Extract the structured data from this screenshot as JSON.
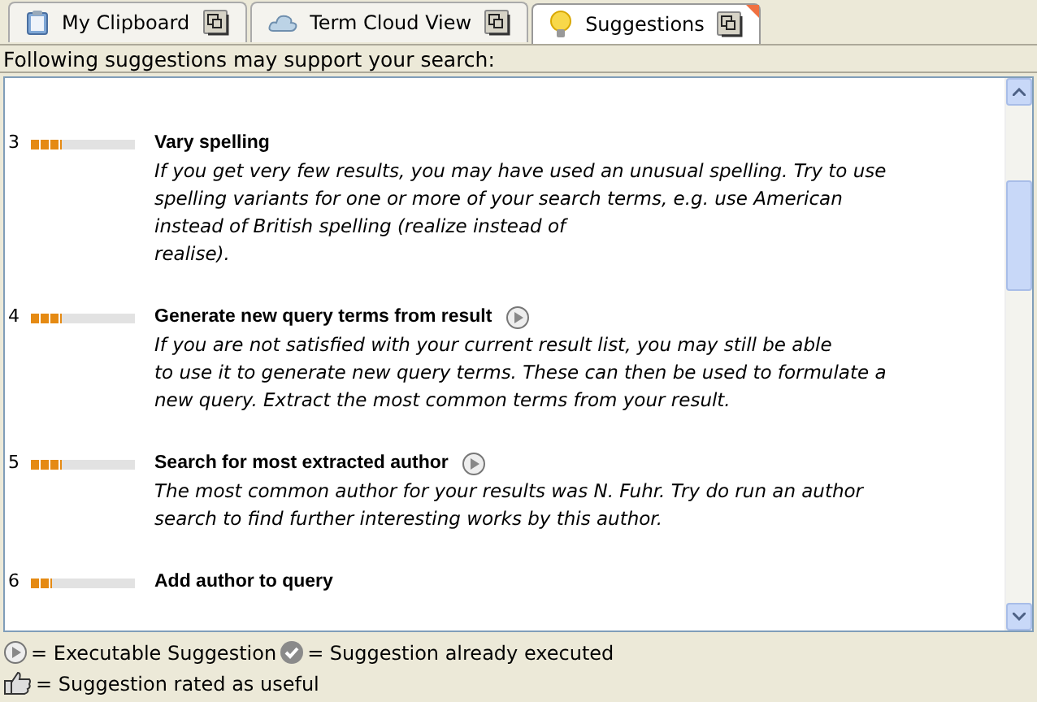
{
  "tabs": [
    {
      "label": "My Clipboard",
      "kind": "clipboard",
      "selected": false
    },
    {
      "label": "Term Cloud View",
      "kind": "cloud",
      "selected": false
    },
    {
      "label": "Suggestions",
      "kind": "bulb",
      "selected": true
    }
  ],
  "intro": "Following suggestions may support your search:",
  "suggestions": [
    {
      "number": "3",
      "level": 0.3,
      "title": "Vary spelling",
      "executable": false,
      "description": "If you get very few results, you may have used an unusual spelling. Try to use\nspelling variants for one or more of your search terms, e.g. use American\ninstead of British spelling (realize instead of\nrealise)."
    },
    {
      "number": "4",
      "level": 0.3,
      "title": "Generate new query terms from result",
      "executable": true,
      "description": "If you are not satisfied with your current result list, you may still be able\nto use it to generate new query terms. These can then be used to formulate a\nnew query. Extract the most common terms from your result."
    },
    {
      "number": "5",
      "level": 0.3,
      "title": "Search for most extracted author",
      "executable": true,
      "description": "The most common author for your results was N. Fuhr. Try do run an author\nsearch to find further interesting works by this author."
    },
    {
      "number": "6",
      "level": 0.2,
      "title": "Add author to query",
      "executable": false
    }
  ],
  "legend": [
    {
      "kind": "play",
      "text": "= Executable Suggestion"
    },
    {
      "kind": "check",
      "text": "= Suggestion already executed"
    },
    {
      "kind": "hand",
      "text": "= Suggestion rated as useful"
    }
  ]
}
